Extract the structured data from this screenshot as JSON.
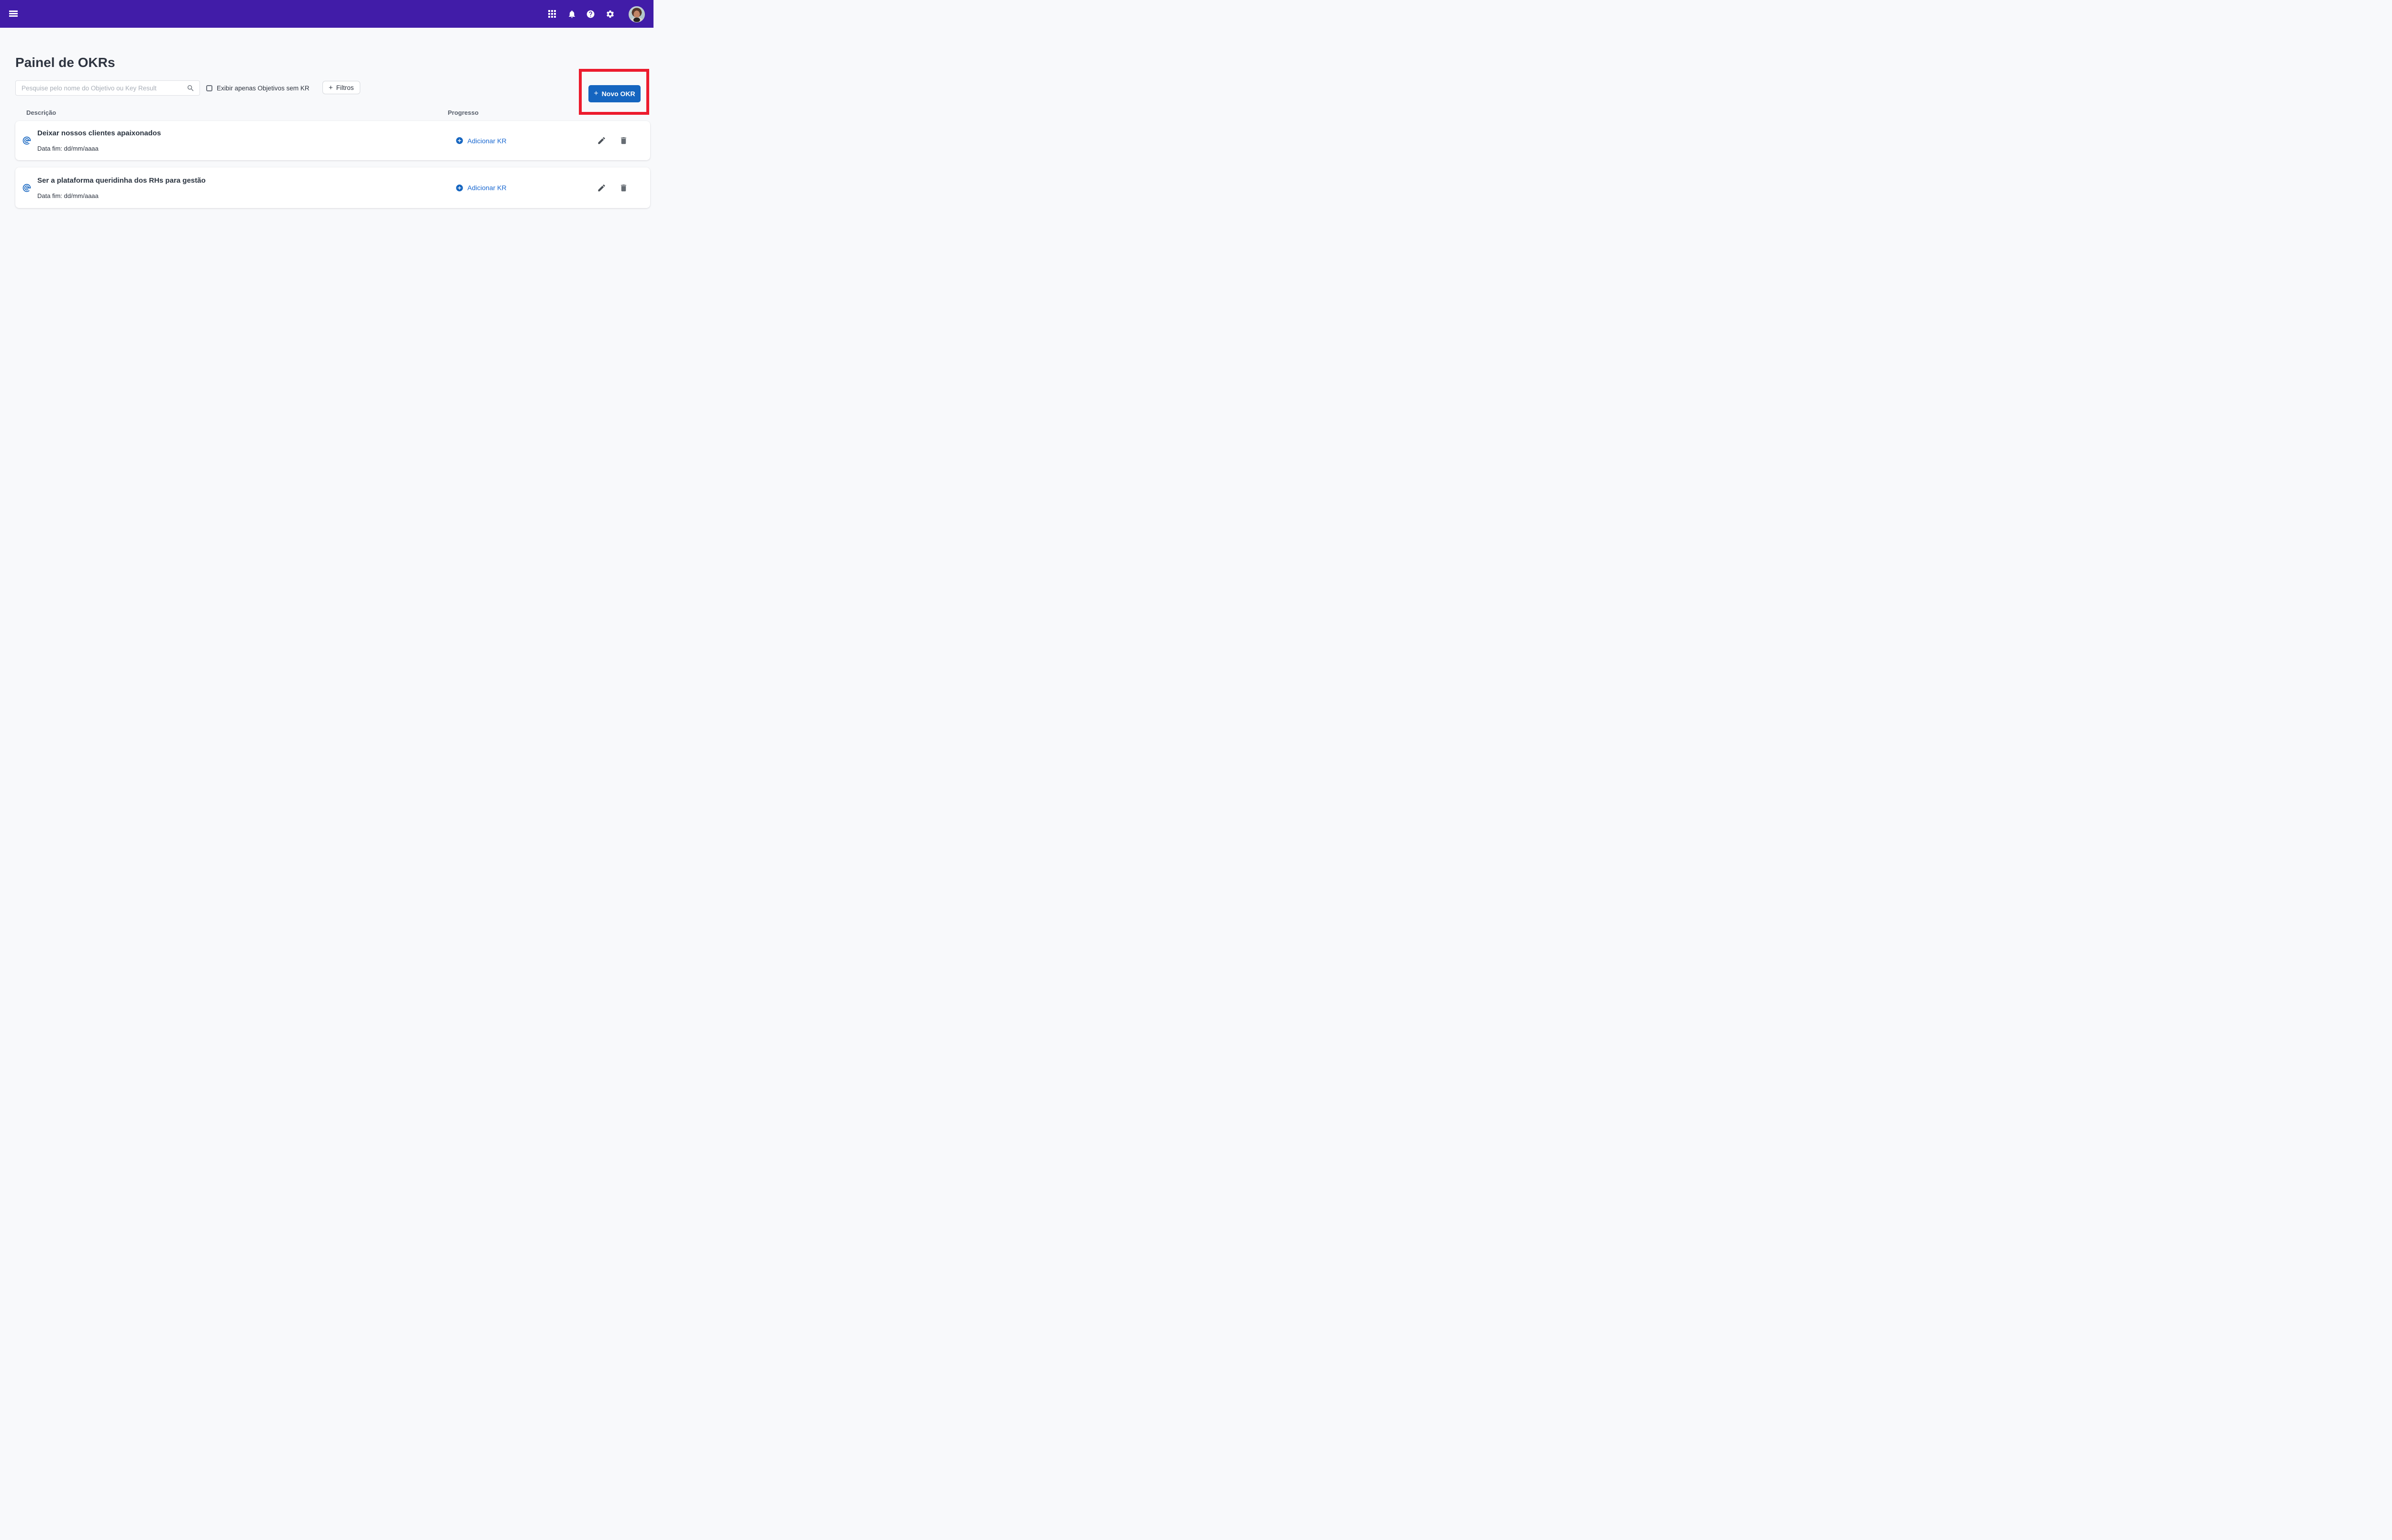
{
  "colors": {
    "topbar_bg": "#411CA8",
    "page_bg": "#F8F9FB",
    "primary_blue": "#1565C0",
    "link_blue": "#1968D1",
    "annotation_red": "#EC1B2D",
    "heading_text": "#2E3440",
    "column_header_text": "#59606C"
  },
  "topbar": {
    "menu_icon": "hamburger-menu",
    "apps_icon": "apps-grid",
    "notifications_icon": "notifications-bell",
    "help_icon": "help-question",
    "settings_icon": "settings-gear",
    "avatar": "user-profile-photo"
  },
  "page": {
    "title": "Painel de OKRs"
  },
  "controls": {
    "search": {
      "placeholder": "Pesquise pelo nome do Objetivo ou Key Result",
      "value": "",
      "icon": "search-magnifier"
    },
    "filter_checkbox": {
      "label": "Exibir apenas Objetivos sem KR",
      "checked": false
    },
    "filters_button": {
      "plus": "+",
      "label": "Filtros"
    },
    "new_okr_button": {
      "plus": "+",
      "label": "Novo OKR",
      "highlighted_with_red_box": true
    }
  },
  "table": {
    "description_header": "Descrição",
    "progress_header": "Progresso"
  },
  "okrs": [
    {
      "title": "Deixar nossos clientes apaixonados",
      "end_date": "Data fim: dd/mm/aaaa",
      "add_kr_label": "Adicionar KR",
      "objective_icon": "objective-target-spiral",
      "actions": [
        "edit-pencil",
        "delete-trash"
      ]
    },
    {
      "title": "Ser a plataforma queridinha dos RHs para gestão",
      "end_date": "Data fim: dd/mm/aaaa",
      "add_kr_label": "Adicionar KR",
      "objective_icon": "objective-target-spiral",
      "actions": [
        "edit-pencil",
        "delete-trash"
      ]
    }
  ]
}
